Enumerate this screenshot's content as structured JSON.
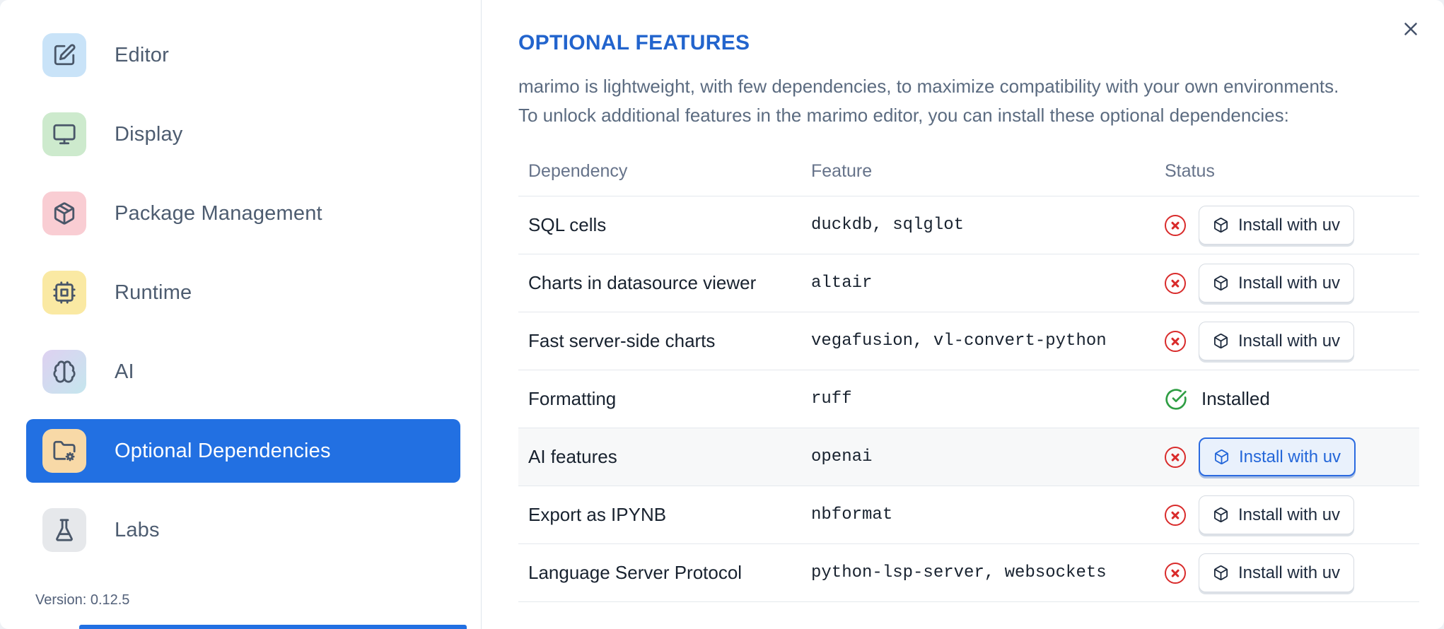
{
  "colors": {
    "accent": "#2270e2",
    "title_blue": "#2264cd",
    "error_red": "#d92b2b",
    "success_green": "#2f9e44"
  },
  "sidebar": {
    "items": [
      {
        "label": "Editor",
        "icon": "edit-icon",
        "tile_color": "#c9e3f8"
      },
      {
        "label": "Display",
        "icon": "monitor-icon",
        "tile_color": "#cdeacd"
      },
      {
        "label": "Package Management",
        "icon": "package-icon",
        "tile_color": "#f9cdd3"
      },
      {
        "label": "Runtime",
        "icon": "cpu-icon",
        "tile_color": "#fae9a3"
      },
      {
        "label": "AI",
        "icon": "brain-icon",
        "tile_color": "linear-gradient(135deg,#ded1f1 0%,#c5e6ee 100%)"
      },
      {
        "label": "Optional Dependencies",
        "icon": "folder-cog-icon",
        "tile_color": "#f8d9a7",
        "selected": true
      },
      {
        "label": "Labs",
        "icon": "flask-icon",
        "tile_color": "#e6e8eb"
      }
    ],
    "version": "Version: 0.12.5"
  },
  "dialog": {
    "title": "OPTIONAL FEATURES",
    "description_line1": "marimo is lightweight, with few dependencies, to maximize compatibility with your own environments.",
    "description_line2": "To unlock additional features in the marimo editor, you can install these optional dependencies:",
    "table": {
      "columns": [
        "Dependency",
        "Feature",
        "Status"
      ],
      "rows": [
        {
          "dependency": "SQL cells",
          "feature": "duckdb, sqlglot",
          "status": "not-installed",
          "action_label": "Install with uv"
        },
        {
          "dependency": "Charts in datasource viewer",
          "feature": "altair",
          "status": "not-installed",
          "action_label": "Install with uv"
        },
        {
          "dependency": "Fast server-side charts",
          "feature": "vegafusion, vl-convert-python",
          "status": "not-installed",
          "action_label": "Install with uv"
        },
        {
          "dependency": "Formatting",
          "feature": "ruff",
          "status": "installed",
          "status_label": "Installed"
        },
        {
          "dependency": "AI features",
          "feature": "openai",
          "status": "not-installed",
          "action_label": "Install with uv",
          "highlighted": true
        },
        {
          "dependency": "Export as IPYNB",
          "feature": "nbformat",
          "status": "not-installed",
          "action_label": "Install with uv"
        },
        {
          "dependency": "Language Server Protocol",
          "feature": "python-lsp-server, websockets",
          "status": "not-installed",
          "action_label": "Install with uv"
        }
      ]
    }
  }
}
